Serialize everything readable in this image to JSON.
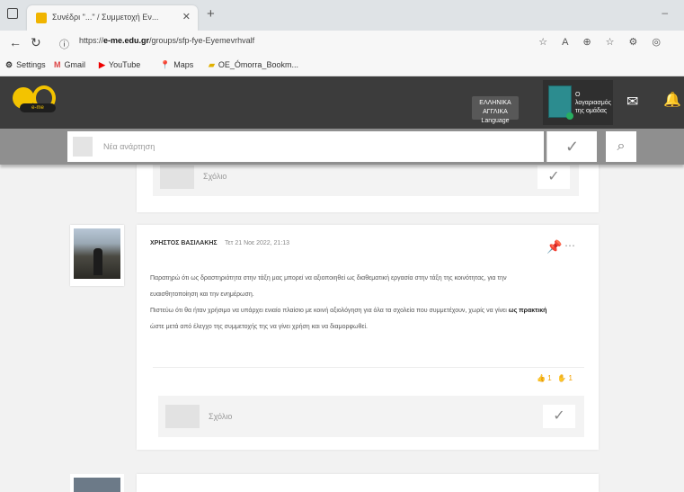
{
  "browser": {
    "tab_title": "Συνέδρι \"...\" / Συμμετοχή Εν...",
    "url_prefix": "https://",
    "url_domain": "e-me.edu.gr",
    "url_path": "/groups/sfp-fye-Eyemevrhvalf",
    "bookmarks": [
      "Settings",
      "Gmail",
      "YouTube",
      "Maps",
      "OE_Ómorra_Βookm..."
    ]
  },
  "header": {
    "logo_text": "e-me",
    "language_label": "Language",
    "language_top": "ΕΛΛΗΝΙΚΑ ΑΓΓΛΙΚΑ",
    "user_line1": "Ο λογαριασμός",
    "user_line2": "της ομάδας"
  },
  "composer": {
    "placeholder": "Νέα ανάρτηση"
  },
  "replies": {
    "placeholder": "Σχόλιο"
  },
  "post": {
    "author": "ΧΡΗΣΤΟΣ ΒΑΣΙΛΑΚΗΣ",
    "date": "Τετ 21 Νοε 2022, 21:13",
    "paragraphs": [
      "Παρατηρώ ότι ως δραστηριότητα στην τάξη μας μπορεί να αξιοποιηθεί ως διαθεματική εργασία στην τάξη της κοινότητας, για την",
      "ευαισθητοποίηση και την ενημέρωση.",
      "Πιστεύω ότι θα ήταν χρήσιμο να υπάρχει ενιαίο πλαίσιο με κοινή αξιολόγηση για όλα τα σχολεία που συμμετέχουν, χωρίς να γίνει ",
      "ώστε μετά από έλεγχο της συμμετοχής της να γίνει χρήση και να διαμορφωθεί."
    ],
    "bold_phrase": "ως πρακτική",
    "likes": "1",
    "reactions": "1"
  }
}
